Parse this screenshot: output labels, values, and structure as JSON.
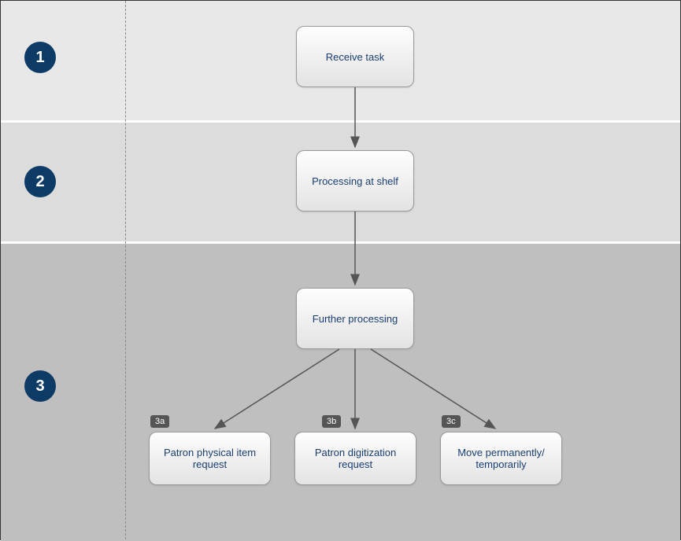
{
  "lanes": {
    "step1": {
      "number": "1"
    },
    "step2": {
      "number": "2"
    },
    "step3": {
      "number": "3"
    }
  },
  "nodes": {
    "receive_task": "Receive task",
    "processing_shelf": "Processing at shelf",
    "further_processing": "Further processing",
    "patron_physical": "Patron physical item request",
    "patron_digitization": "Patron digitization request",
    "move": "Move permanently/ temporarily"
  },
  "sub_badges": {
    "a": "3a",
    "b": "3b",
    "c": "3c"
  }
}
